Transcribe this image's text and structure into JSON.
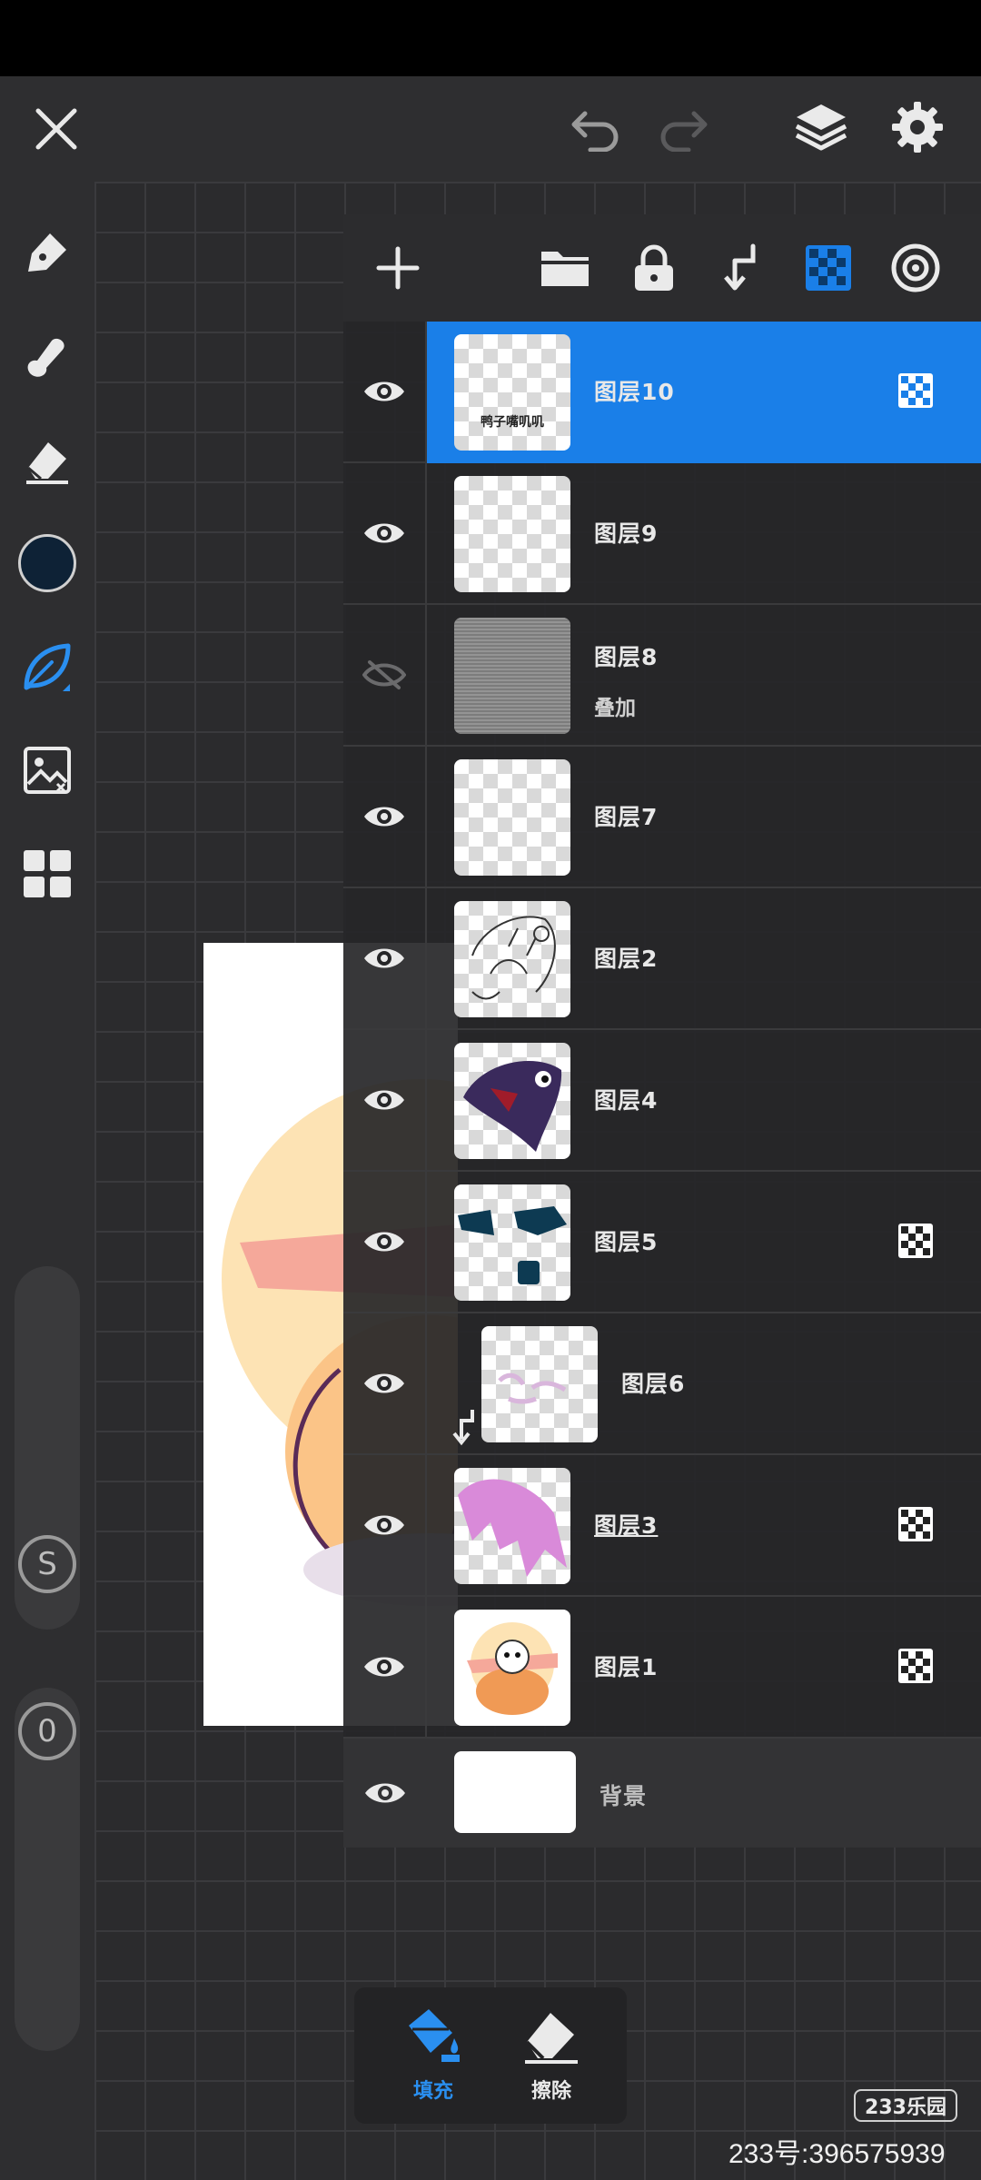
{
  "top_toolbar": {
    "close_icon": "close-icon",
    "undo_icon": "undo-icon",
    "redo_icon": "redo-icon",
    "layers_icon": "layers-icon",
    "settings_icon": "gear-icon"
  },
  "left_tools": {
    "items": [
      "pen-icon",
      "smudge-icon",
      "eraser-icon",
      "color-swatch",
      "brush-leaf-icon",
      "image-import-icon",
      "grid-menu-icon"
    ],
    "current_color": "#0e2236",
    "size_slider_label": "S",
    "opacity_slider_label": "0"
  },
  "layers_toolbar": {
    "items": [
      "add-icon",
      "folder-icon",
      "lock-icon",
      "clip-icon",
      "alpha-lock-icon",
      "mask-icon"
    ]
  },
  "layers": [
    {
      "name": "图层10",
      "visible": true,
      "selected": true,
      "alpha_lock": true,
      "thumb_text": "鸭子嘴叽叽"
    },
    {
      "name": "图层9",
      "visible": true
    },
    {
      "name": "图层8",
      "visible": false,
      "mode": "叠加"
    },
    {
      "name": "图层7",
      "visible": true
    },
    {
      "name": "图层2",
      "visible": true
    },
    {
      "name": "图层4",
      "visible": true
    },
    {
      "name": "图层5",
      "visible": true,
      "alpha_lock": true
    },
    {
      "name": "图层6",
      "visible": true,
      "clipped": true
    },
    {
      "name": "图层3",
      "visible": true,
      "alpha_lock": true
    },
    {
      "name": "图层1",
      "visible": true,
      "alpha_lock": true
    },
    {
      "name": "背景",
      "visible": true,
      "background": true
    }
  ],
  "bottom_tools": {
    "fill_label": "填充",
    "erase_label": "擦除"
  },
  "watermark": {
    "logo": "233乐园",
    "id_text": "233号:396575939"
  },
  "colors": {
    "accent": "#1a7fe8",
    "panel": "#262628",
    "toolbar": "#2e2e30"
  }
}
